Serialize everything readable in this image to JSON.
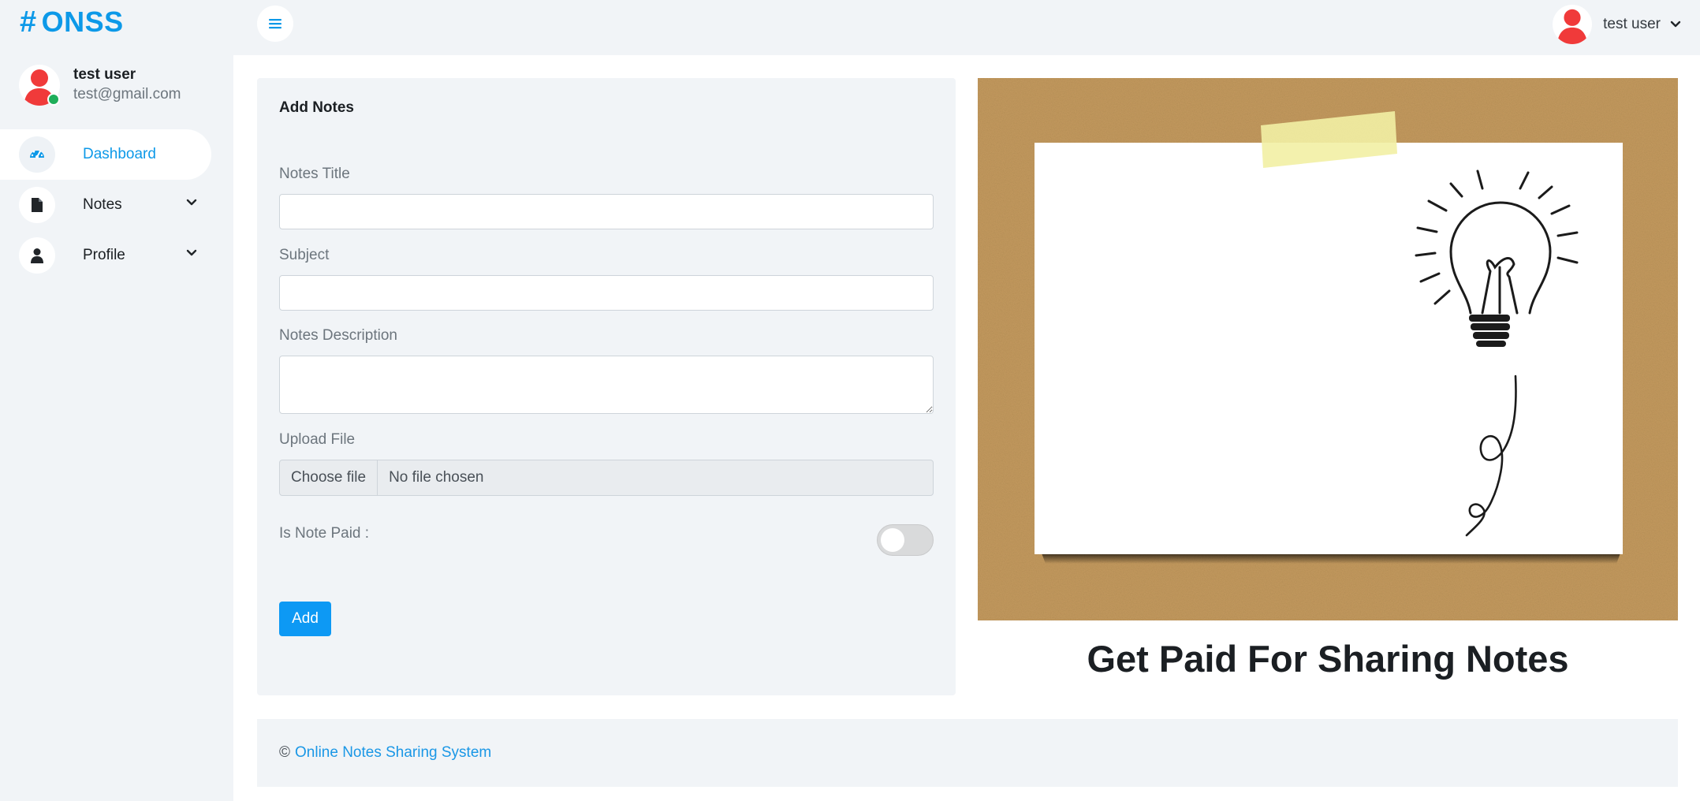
{
  "brand": {
    "symbol": "#",
    "name": "ONSS"
  },
  "sidebar": {
    "user": {
      "name": "test user",
      "email": "test@gmail.com"
    },
    "items": [
      {
        "label": "Dashboard",
        "icon": "speedometer-icon",
        "active": true
      },
      {
        "label": "Notes",
        "icon": "file-icon"
      },
      {
        "label": "Profile",
        "icon": "user-icon"
      }
    ]
  },
  "header": {
    "user_name": "test user"
  },
  "form": {
    "title": "Add Notes",
    "notes_title_label": "Notes Title",
    "notes_title_value": "",
    "subject_label": "Subject",
    "subject_value": "",
    "description_label": "Notes Description",
    "description_value": "",
    "upload_label": "Upload File",
    "choose_file_label": "Choose file",
    "file_status": "No file chosen",
    "paid_label": "Is Note Paid :",
    "paid_on": false,
    "submit_label": "Add"
  },
  "promo": {
    "title": "Get Paid For Sharing Notes"
  },
  "footer": {
    "copyright": "©",
    "link": "Online Notes Sharing System"
  },
  "colors": {
    "accent": "#0d99e8",
    "avatar_red": "#f03a3a",
    "online": "#1fae5a",
    "cork": "#c49a5e"
  }
}
